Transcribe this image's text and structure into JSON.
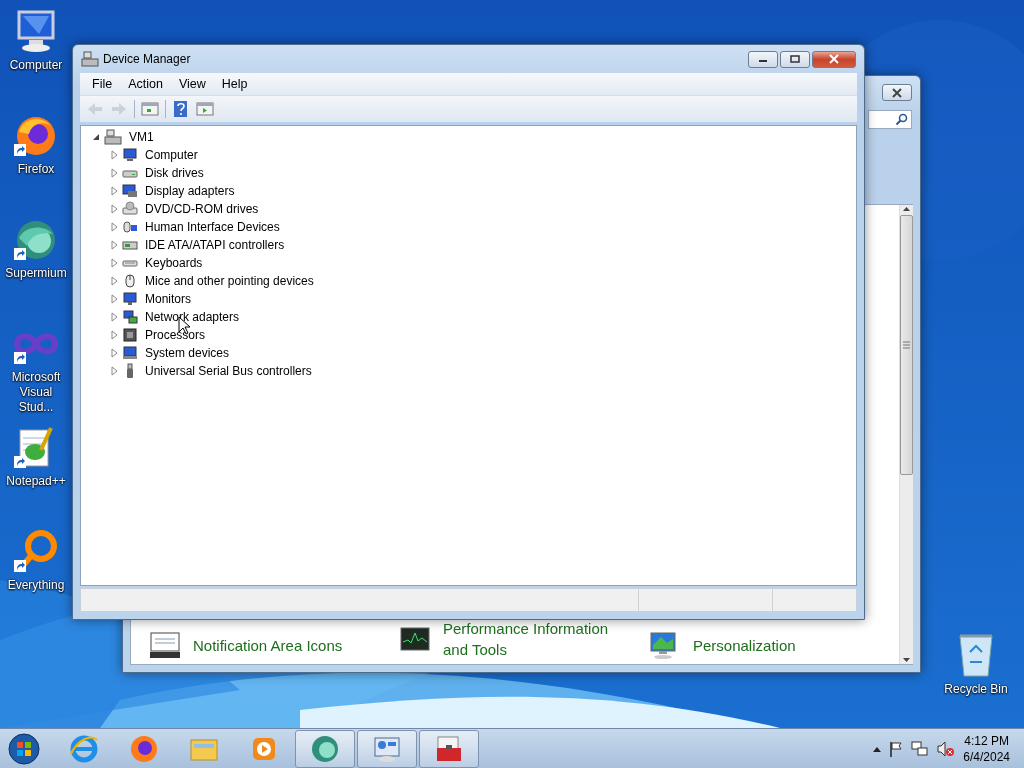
{
  "desktop_icons": [
    {
      "label": "Computer",
      "kind": "computer",
      "shortcut": false
    },
    {
      "label": "Firefox",
      "kind": "firefox",
      "shortcut": true
    },
    {
      "label": "Supermium",
      "kind": "supermium",
      "shortcut": true
    },
    {
      "label": "Microsoft Visual Stud...",
      "kind": "vs",
      "shortcut": true
    },
    {
      "label": "Notepad++",
      "kind": "notepad",
      "shortcut": true
    },
    {
      "label": "Everything",
      "kind": "everything",
      "shortcut": true
    }
  ],
  "recycle_bin": {
    "label": "Recycle Bin"
  },
  "background_window": {
    "items": [
      {
        "label": "Notification Area Icons",
        "kind": "tray"
      },
      {
        "label": "Performance Information and Tools",
        "kind": "performance"
      },
      {
        "label": "Personalization",
        "kind": "personalization"
      }
    ]
  },
  "device_manager": {
    "title": "Device Manager",
    "menu": [
      "File",
      "Action",
      "View",
      "Help"
    ],
    "toolbar": [
      {
        "kind": "back",
        "disabled": true
      },
      {
        "kind": "forward",
        "disabled": true
      },
      {
        "kind": "tree",
        "disabled": false
      },
      {
        "kind": "help",
        "disabled": false
      },
      {
        "kind": "properties",
        "disabled": false
      }
    ],
    "tree": {
      "label": "VM1",
      "expanded": true,
      "children": [
        {
          "label": "Computer",
          "kind": "computer",
          "expanded": false
        },
        {
          "label": "Disk drives",
          "kind": "disk",
          "expanded": false
        },
        {
          "label": "Display adapters",
          "kind": "display",
          "expanded": false
        },
        {
          "label": "DVD/CD-ROM drives",
          "kind": "dvd",
          "expanded": false
        },
        {
          "label": "Human Interface Devices",
          "kind": "hid",
          "expanded": false
        },
        {
          "label": "IDE ATA/ATAPI controllers",
          "kind": "ide",
          "expanded": false
        },
        {
          "label": "Keyboards",
          "kind": "keyboard",
          "expanded": false
        },
        {
          "label": "Mice and other pointing devices",
          "kind": "mouse",
          "expanded": false
        },
        {
          "label": "Monitors",
          "kind": "monitor",
          "expanded": false
        },
        {
          "label": "Network adapters",
          "kind": "network",
          "expanded": false
        },
        {
          "label": "Processors",
          "kind": "processor",
          "expanded": false
        },
        {
          "label": "System devices",
          "kind": "system",
          "expanded": false
        },
        {
          "label": "Universal Serial Bus controllers",
          "kind": "usb",
          "expanded": false
        }
      ]
    }
  },
  "taskbar": {
    "apps": [
      {
        "kind": "ie",
        "running": false
      },
      {
        "kind": "firefox",
        "running": false
      },
      {
        "kind": "explorer",
        "running": false
      },
      {
        "kind": "media",
        "running": false
      },
      {
        "kind": "supermium",
        "running": true
      },
      {
        "kind": "control_panel",
        "running": true
      },
      {
        "kind": "device_manager",
        "running": true
      }
    ],
    "clock": {
      "time": "4:12 PM",
      "date": "6/4/2024"
    }
  }
}
